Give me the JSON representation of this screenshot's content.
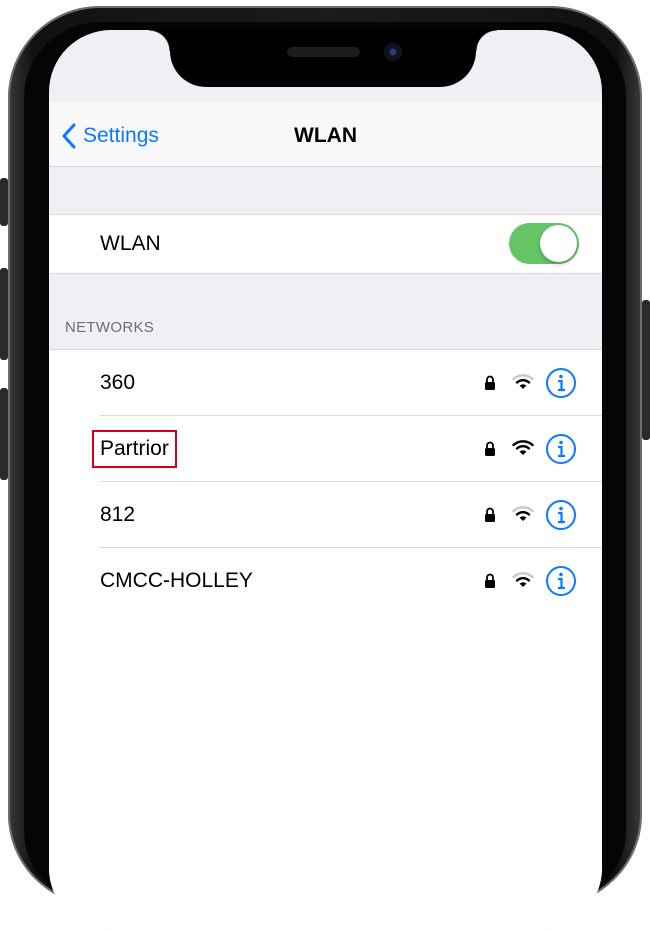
{
  "navbar": {
    "back_label": "Settings",
    "title": "WLAN"
  },
  "wlan_toggle": {
    "label": "WLAN",
    "state": "on",
    "on_color": "#65c466"
  },
  "networks_section": {
    "header": "NETWORKS",
    "items": [
      {
        "name": "360",
        "secured": true,
        "signal": "medium",
        "highlighted": false
      },
      {
        "name": "Partrior",
        "secured": true,
        "signal": "full",
        "highlighted": true
      },
      {
        "name": "812",
        "secured": true,
        "signal": "medium",
        "highlighted": false
      },
      {
        "name": "CMCC-HOLLEY",
        "secured": true,
        "signal": "medium",
        "highlighted": false
      }
    ]
  },
  "colors": {
    "accent": "#0a7aff",
    "grouped_background": "#efeff4",
    "highlight_box": "#d0021b"
  },
  "icons": {
    "back": "chevron-left-icon",
    "secured": "lock-icon",
    "signal": "wifi-icon",
    "details": "info-icon"
  }
}
